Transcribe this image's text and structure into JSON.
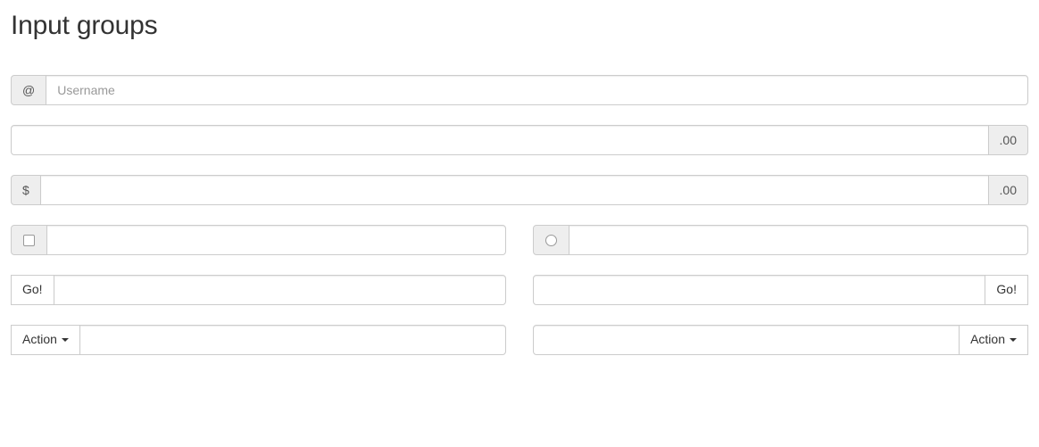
{
  "page": {
    "title": "Input groups"
  },
  "groups": {
    "username": {
      "addon": "@",
      "placeholder": "Username",
      "value": ""
    },
    "cents_suffix": {
      "addon": ".00",
      "placeholder": "",
      "value": ""
    },
    "dollars_cents": {
      "prefix_addon": "$",
      "suffix_addon": ".00",
      "placeholder": "",
      "value": ""
    },
    "checkbox_group": {
      "addon_icon": "checkbox-unchecked",
      "placeholder": "",
      "value": ""
    },
    "radio_group": {
      "addon_icon": "radio-unchecked",
      "placeholder": "",
      "value": ""
    },
    "button_prefix": {
      "button_label": "Go!",
      "placeholder": "",
      "value": ""
    },
    "button_suffix": {
      "button_label": "Go!",
      "placeholder": "",
      "value": ""
    },
    "dropdown_prefix": {
      "button_label": "Action",
      "caret_icon": "caret-down-icon",
      "placeholder": "",
      "value": ""
    },
    "dropdown_suffix": {
      "button_label": "Action",
      "caret_icon": "caret-down-icon",
      "placeholder": "",
      "value": ""
    }
  },
  "colors": {
    "addon_bg": "#eeeeee",
    "border": "#cccccc",
    "text": "#333333",
    "placeholder": "#999999",
    "input_bg": "#ffffff"
  }
}
